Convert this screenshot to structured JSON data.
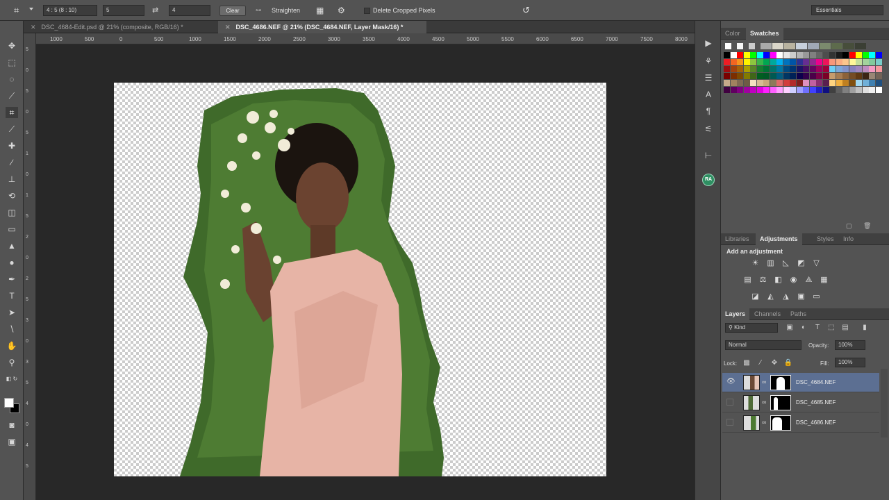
{
  "options_bar": {
    "ratio_preset": "4 : 5 (8 : 10)",
    "width_value": "5",
    "height_value": "4",
    "clear_label": "Clear",
    "straighten_label": "Straighten",
    "delete_cropped_label": "Delete Cropped Pixels",
    "workspace": "Essentials"
  },
  "tabs": [
    {
      "label": "DSC_4684-Edit.psd @ 21% (composite, RGB/16) *",
      "active": false
    },
    {
      "label": "DSC_4686.NEF @ 21% (DSC_4684.NEF, Layer Mask/16) *",
      "active": true
    }
  ],
  "ruler": {
    "h_ticks": [
      "1000",
      "500",
      "0",
      "500",
      "1000",
      "1500",
      "2000",
      "2500",
      "3000",
      "3500",
      "4000",
      "4500",
      "5000",
      "5500",
      "6000",
      "6500",
      "7000",
      "7500",
      "8000"
    ],
    "v_ticks": [
      "5",
      "0",
      "5",
      "0",
      "5",
      "1",
      "0",
      "1",
      "5",
      "2",
      "0",
      "2",
      "5",
      "3",
      "0",
      "3",
      "5",
      "4",
      "0",
      "4",
      "5"
    ]
  },
  "color_panel": {
    "tabs": [
      "Color",
      "Swatches"
    ],
    "active_tab": "Swatches"
  },
  "adjust_panel": {
    "tabs": [
      "Libraries",
      "Adjustments",
      "Styles",
      "Info"
    ],
    "active_tab": "Adjustments",
    "title": "Add an adjustment"
  },
  "layers_panel": {
    "tabs": [
      "Layers",
      "Channels",
      "Paths"
    ],
    "active_tab": "Layers",
    "filter_kind": "Kind",
    "blend_mode": "Normal",
    "opacity_label": "Opacity:",
    "opacity_value": "100%",
    "lock_label": "Lock:",
    "fill_label": "Fill:",
    "fill_value": "100%",
    "layers": [
      {
        "name": "DSC_4684.NEF",
        "visible": true,
        "selected": true
      },
      {
        "name": "DSC_4685.NEF",
        "visible": false,
        "selected": false
      },
      {
        "name": "DSC_4686.NEF",
        "visible": false,
        "selected": false
      }
    ]
  },
  "user_badge": "RA",
  "colors": {
    "swatch_rows": [
      [
        "#000000",
        "#ffffff",
        "#ff0000",
        "#ffff00",
        "#00ff00",
        "#00ffff",
        "#0000ff",
        "#ff00ff",
        "#ffffff",
        "#e6e6e6",
        "#cccccc",
        "#b3b3b3",
        "#999999",
        "#808080",
        "#666666",
        "#4d4d4d",
        "#333333",
        "#1a1a1a",
        "#000000",
        "#ff0000",
        "#ffff00",
        "#00ff00",
        "#00ffff",
        "#0000ff"
      ],
      [
        "#ed1c24",
        "#f26522",
        "#f7941d",
        "#fff200",
        "#8dc63f",
        "#39b54a",
        "#00a651",
        "#00a99d",
        "#00aeef",
        "#0072bc",
        "#0054a6",
        "#2e3192",
        "#662d91",
        "#92278f",
        "#ec008c",
        "#ed145b",
        "#f7977a",
        "#fbad82",
        "#fdc68c",
        "#fff799",
        "#c4df9b",
        "#a3d39c",
        "#82ca9c",
        "#7accc8"
      ],
      [
        "#9e0b0f",
        "#a0410d",
        "#a36209",
        "#aba000",
        "#598527",
        "#197b30",
        "#007236",
        "#00746b",
        "#0076a3",
        "#004a80",
        "#003471",
        "#1b1464",
        "#440e62",
        "#630460",
        "#9e005d",
        "#9e0039",
        "#6dcff6",
        "#7da7d9",
        "#8393ca",
        "#8781bd",
        "#a187be",
        "#bd8cbf",
        "#f49ac2",
        "#f6989d"
      ],
      [
        "#790000",
        "#7b2e00",
        "#7d4900",
        "#827b00",
        "#406618",
        "#005e20",
        "#005826",
        "#005952",
        "#005b7f",
        "#003663",
        "#002157",
        "#0d004c",
        "#32004b",
        "#4b0049",
        "#7b0046",
        "#7a0026",
        "#c69c6d",
        "#a67c52",
        "#8c6239",
        "#754c24",
        "#603913",
        "#3c2415",
        "#998675",
        "#736357"
      ]
    ]
  }
}
